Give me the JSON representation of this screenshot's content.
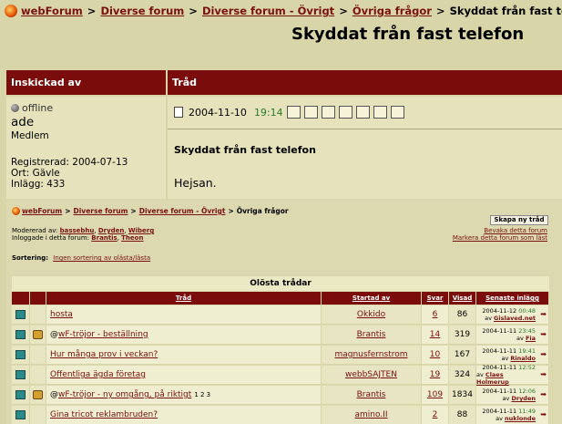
{
  "breadcrumb": {
    "items": [
      "webForum",
      "Diverse forum",
      "Diverse forum - Övrigt",
      "Övriga frågor"
    ],
    "current": "Skyddat från fast telefon",
    "sep": ">"
  },
  "page_title": "Skyddat från fast telefon",
  "headers": {
    "author": "Inskickad av",
    "thread": "Tråd"
  },
  "user": {
    "status": "offline",
    "name": "ade",
    "role": "Medlem",
    "registered": "Registrerad: 2004-07-13",
    "city": "Ort: Gävle",
    "posts": "Inlägg: 433"
  },
  "post": {
    "date": "2004-11-10",
    "time": "19:14",
    "subject": "Skyddat från fast telefon",
    "body": "Hejsan."
  },
  "embedded": {
    "breadcrumb": [
      "webForum",
      "Diverse forum",
      "Diverse forum - Övrigt"
    ],
    "breadcrumb_current": "Övriga frågor",
    "new_thread_button": "Skapa ny tråd",
    "watch_forum": "Bevaka detta forum",
    "mark_read": "Markera detta forum som läst",
    "moderated_label": "Modererad av:",
    "moderators": [
      "bassebhu",
      "Dryden",
      "Wiberg"
    ],
    "logged_in_label": "Inloggade i detta forum:",
    "logged_in": [
      "Brantis",
      "Theon"
    ],
    "sort_label": "Sortering:",
    "sort_value": "Ingen sortering av olästa/lästa",
    "list_heading": "Olösta trådar",
    "columns": {
      "thread": "Tråd",
      "started_by": "Startad av",
      "replies": "Svar",
      "views": "Visad",
      "last": "Senaste inlägg"
    },
    "threads": [
      {
        "title": "hosta",
        "by": "Okkido",
        "replies": "6",
        "views": "86",
        "date": "2004-11-12",
        "time": "00:48",
        "last_by_label": "av",
        "last_by": "Gislaved.net",
        "locked": false,
        "prefix": "",
        "pages": ""
      },
      {
        "title": "wF-tröjor - beställning",
        "by": "Brantis",
        "replies": "14",
        "views": "319",
        "date": "2004-11-11",
        "time": "23:45",
        "last_by_label": "av",
        "last_by": "Fia",
        "locked": true,
        "prefix": "@",
        "pages": ""
      },
      {
        "title": "Hur många prov i veckan?",
        "by": "magnusfernstrom",
        "replies": "10",
        "views": "167",
        "date": "2004-11-11",
        "time": "19:41",
        "last_by_label": "av",
        "last_by": "Rinaldo",
        "locked": false,
        "prefix": "",
        "pages": ""
      },
      {
        "title": "Offentliga ägda företag",
        "by": "webbSAJTEN",
        "replies": "19",
        "views": "324",
        "date": "2004-11-11",
        "time": "12:52",
        "last_by_label": "av",
        "last_by": "Claes Holmerup",
        "locked": false,
        "prefix": "",
        "pages": ""
      },
      {
        "title": "wF-tröjor - ny omgång, på riktigt",
        "by": "Brantis",
        "replies": "109",
        "views": "1834",
        "date": "2004-11-11",
        "time": "12:06",
        "last_by_label": "av",
        "last_by": "Dryden",
        "locked": true,
        "prefix": "@",
        "pages": "1 2 3"
      },
      {
        "title": "Gina tricot reklambruden?",
        "by": "amino.II",
        "replies": "2",
        "views": "88",
        "date": "2004-11-11",
        "time": "11:49",
        "last_by_label": "av",
        "last_by": "nuklonde",
        "locked": false,
        "prefix": "",
        "pages": ""
      }
    ]
  }
}
